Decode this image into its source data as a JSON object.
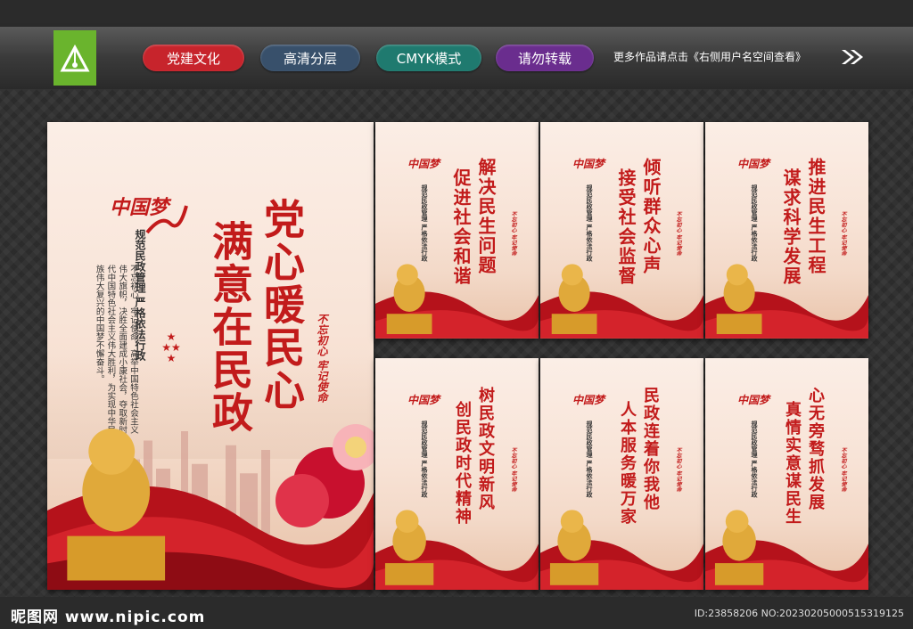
{
  "header": {
    "tags": [
      "党建文化",
      "高清分层",
      "CMYK模式",
      "请勿转载"
    ],
    "more_text": "更多作品请点击《右侧用户名空间查看》",
    "colors": {
      "tag1": "#c7242c",
      "tag2": "#38506b",
      "tag3": "#1f7a6f",
      "tag4": "#6a2d8e",
      "logo": "#6ab42d"
    }
  },
  "main_panel": {
    "title_col1": "党心暖民心",
    "title_col2": "满意在民政",
    "subtitle": "规范民政管理 严格依法行政",
    "body": "不忘初心，牢记使命，高举中国特色社会主义伟大旗帜，决胜全面建成小康社会，夺取新时代中国特色社会主义伟大胜利，为实现中华民族伟大复兴的中国梦不懈奋斗。",
    "logo_text": "中国梦",
    "stamp": "不忘初心 牢记使命"
  },
  "panels": [
    {
      "title_col1": "解决民生问题",
      "title_col2": "促进社会和谐"
    },
    {
      "title_col1": "倾听群众心声",
      "title_col2": "接受社会监督"
    },
    {
      "title_col1": "推进民生工程",
      "title_col2": "谋求科学发展"
    },
    {
      "title_col1": "树民政文明新风",
      "title_col2": "创民政时代精神"
    },
    {
      "title_col1": "民政连着你我他",
      "title_col2": "人本服务暖万家"
    },
    {
      "title_col1": "心无旁骛抓发展",
      "title_col2": "真情实意谋民生"
    }
  ],
  "panel_subtitle": "规范民政管理 严格依法行政",
  "panel_stamp": "不忘初心 牢记使命",
  "footer": {
    "watermark": "昵图网 www.nipic.com",
    "id_text": "ID:23858206 NO:20230205000515319125"
  }
}
